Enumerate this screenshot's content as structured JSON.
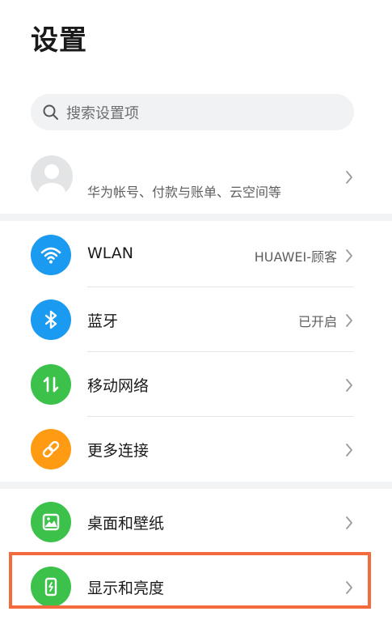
{
  "header": {
    "title": "设置"
  },
  "search": {
    "placeholder": "搜索设置项",
    "icon": "search-icon"
  },
  "account": {
    "description": "华为帐号、付款与账单、云空间等",
    "icon": "avatar-icon"
  },
  "sections": [
    {
      "items": [
        {
          "label": "WLAN",
          "value": "HUAWEI-顾客",
          "icon": "wifi-icon",
          "color": "#1a9af0"
        },
        {
          "label": "蓝牙",
          "value": "已开启",
          "icon": "bluetooth-icon",
          "color": "#1a9af0"
        },
        {
          "label": "移动网络",
          "value": "",
          "icon": "mobile-network-icon",
          "color": "#3cc14a"
        },
        {
          "label": "更多连接",
          "value": "",
          "icon": "link-icon",
          "color": "#ff9a13"
        }
      ]
    },
    {
      "items": [
        {
          "label": "桌面和壁纸",
          "value": "",
          "icon": "wallpaper-icon",
          "color": "#3cc14a"
        },
        {
          "label": "显示和亮度",
          "value": "",
          "icon": "display-brightness-icon",
          "color": "#3cc14a",
          "highlighted": true
        }
      ]
    }
  ],
  "colors": {
    "highlight": "#f36a3d",
    "section_gap": "#f1f3f5",
    "search_bg": "#f1f2f4"
  }
}
